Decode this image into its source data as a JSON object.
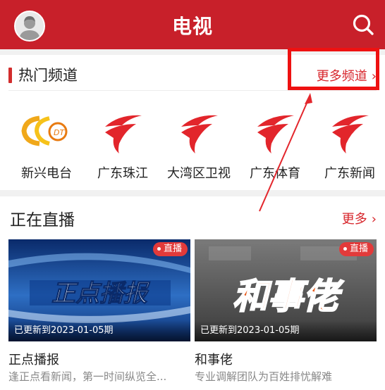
{
  "header": {
    "title": "电视"
  },
  "hot": {
    "title": "热门频道",
    "more_label": "更多频道",
    "channels": [
      {
        "name": "新兴电台",
        "logo": "xinxing-radio-logo"
      },
      {
        "name": "广东珠江",
        "logo": "guangdong-tv-logo"
      },
      {
        "name": "大湾区卫视",
        "logo": "guangdong-tv-logo"
      },
      {
        "name": "广东体育",
        "logo": "guangdong-tv-logo"
      },
      {
        "name": "广东新闻",
        "logo": "guangdong-tv-logo"
      }
    ]
  },
  "live": {
    "title": "正在直播",
    "more_label": "更多",
    "cards": [
      {
        "title": "正点播报",
        "desc": "逢正点看新闻，第一时间纵览全...",
        "updated": "已更新到2023-01-05期",
        "badge": "直播",
        "art_text": "正点播报"
      },
      {
        "title": "和事佬",
        "desc": "专业调解团队为百姓排忧解难",
        "updated": "已更新到2023-01-05期",
        "badge": "直播",
        "art_text": "和事佬"
      }
    ]
  },
  "colors": {
    "brand_red": "#c8202a",
    "accent_red": "#d7252b",
    "annotation_red": "#ee1111"
  },
  "icons": {
    "search": "search-icon",
    "avatar": "user-avatar-icon",
    "chevron": "chevron-right-icon"
  }
}
